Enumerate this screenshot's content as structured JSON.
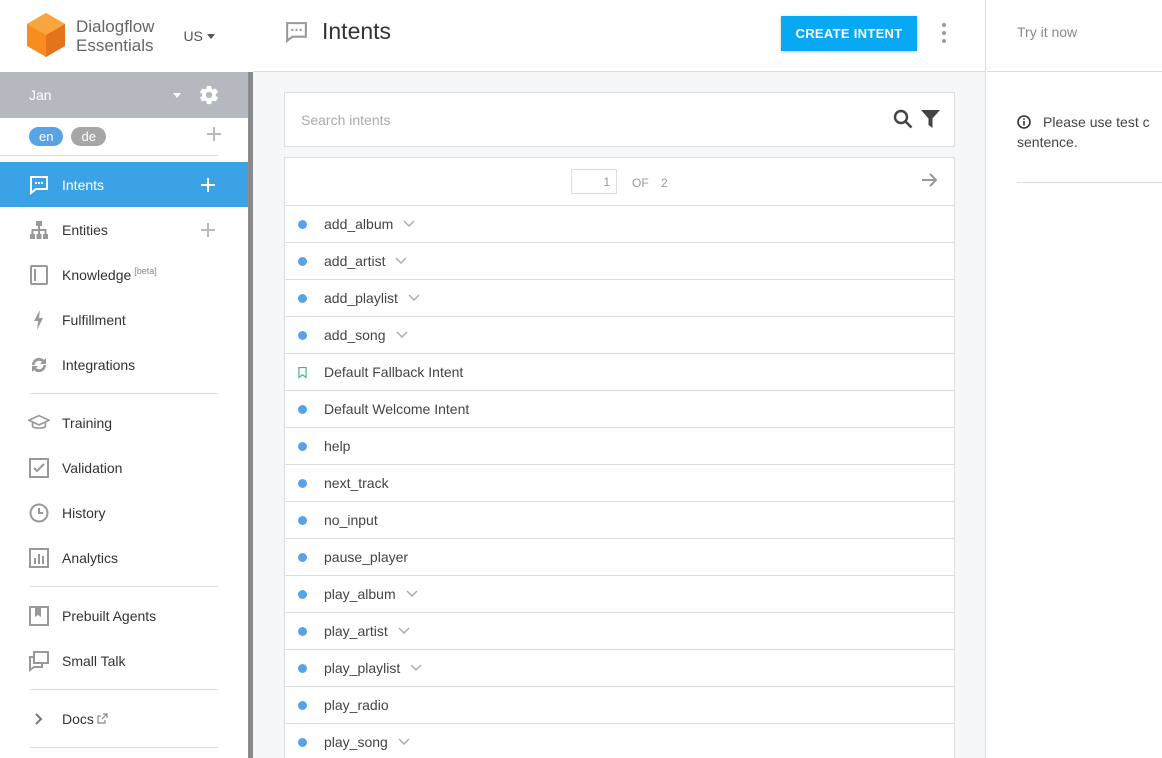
{
  "brand": {
    "name_line1": "Dialogflow",
    "name_line2": "Essentials",
    "region": "US"
  },
  "agent": {
    "name": "Jan",
    "languages": [
      "en",
      "de"
    ]
  },
  "sidebar": {
    "items": [
      {
        "label": "Intents",
        "icon": "chat-icon",
        "active": true,
        "plus": true
      },
      {
        "label": "Entities",
        "icon": "hierarchy-icon",
        "plus": true
      },
      {
        "label": "Knowledge",
        "icon": "book-icon",
        "badge": "[beta]"
      },
      {
        "label": "Fulfillment",
        "icon": "bolt-icon"
      },
      {
        "label": "Integrations",
        "icon": "sync-icon"
      },
      {
        "label": "Training",
        "icon": "graduation-cap-icon"
      },
      {
        "label": "Validation",
        "icon": "check-box-icon"
      },
      {
        "label": "History",
        "icon": "clock-icon"
      },
      {
        "label": "Analytics",
        "icon": "bar-chart-icon"
      },
      {
        "label": "Prebuilt Agents",
        "icon": "bookmark-box-icon"
      },
      {
        "label": "Small Talk",
        "icon": "chat-bubbles-icon"
      },
      {
        "label": "Docs",
        "icon": "chevron-right-icon"
      }
    ]
  },
  "header": {
    "title": "Intents",
    "create_label": "CREATE INTENT"
  },
  "search": {
    "placeholder": "Search intents",
    "value": ""
  },
  "pager": {
    "page": "1",
    "of_label": "OF",
    "total": "2"
  },
  "intents": [
    {
      "name": "add_album",
      "expandable": true,
      "type": "regular"
    },
    {
      "name": "add_artist",
      "expandable": true,
      "type": "regular"
    },
    {
      "name": "add_playlist",
      "expandable": true,
      "type": "regular"
    },
    {
      "name": "add_song",
      "expandable": true,
      "type": "regular"
    },
    {
      "name": "Default Fallback Intent",
      "expandable": false,
      "type": "fallback"
    },
    {
      "name": "Default Welcome Intent",
      "expandable": false,
      "type": "regular"
    },
    {
      "name": "help",
      "expandable": false,
      "type": "regular"
    },
    {
      "name": "next_track",
      "expandable": false,
      "type": "regular"
    },
    {
      "name": "no_input",
      "expandable": false,
      "type": "regular"
    },
    {
      "name": "pause_player",
      "expandable": false,
      "type": "regular"
    },
    {
      "name": "play_album",
      "expandable": true,
      "type": "regular"
    },
    {
      "name": "play_artist",
      "expandable": true,
      "type": "regular"
    },
    {
      "name": "play_playlist",
      "expandable": true,
      "type": "regular"
    },
    {
      "name": "play_radio",
      "expandable": false,
      "type": "regular"
    },
    {
      "name": "play_song",
      "expandable": true,
      "type": "regular"
    }
  ],
  "right_panel": {
    "try_label": "Try it now",
    "note_text": "Please use test c",
    "note_text2": "sentence."
  },
  "colors": {
    "accent": "#3aa3e6",
    "button": "#07a9f2",
    "brand_orange": "#f68d1f",
    "dot": "#5aa2e6",
    "fallback": "#4caf8f"
  }
}
